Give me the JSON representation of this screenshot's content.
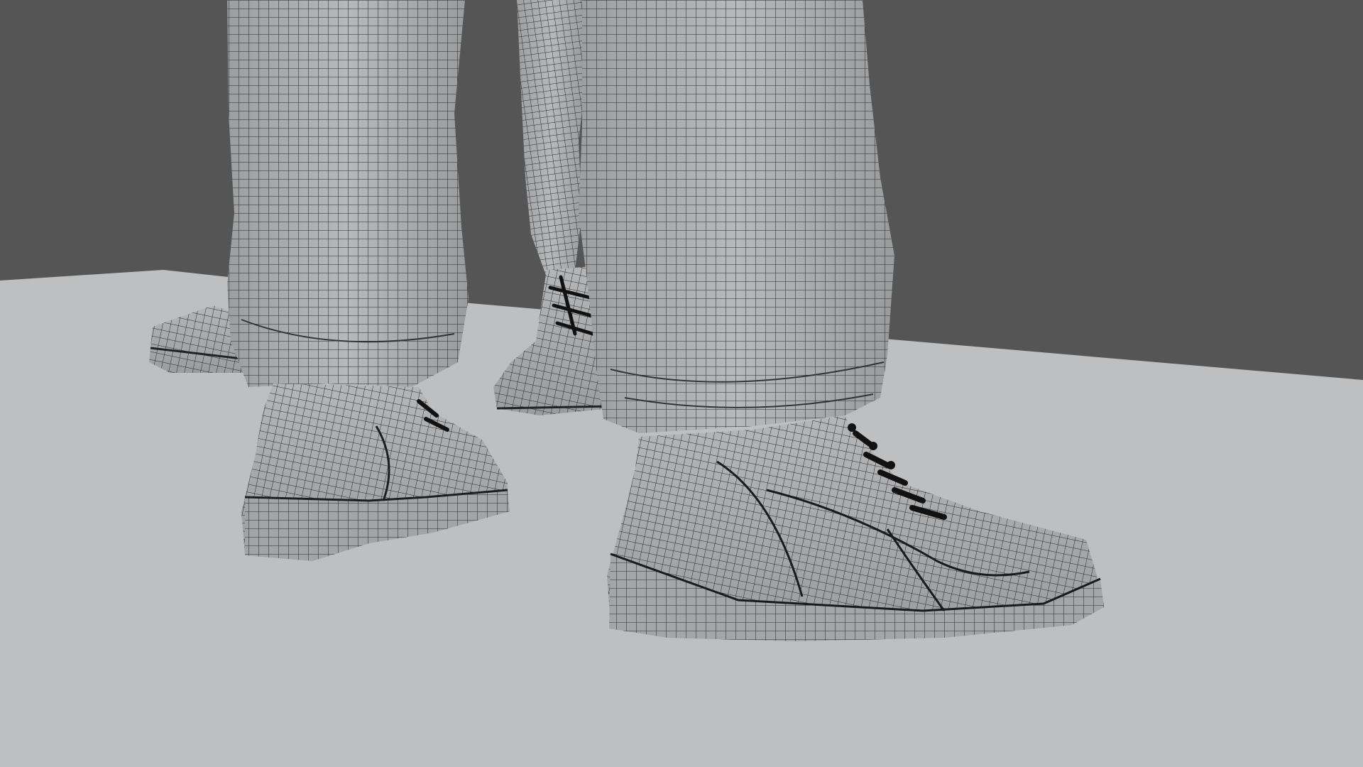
{
  "scene": {
    "description_free": true,
    "colors": {
      "wall": "#555555",
      "floor": "#bdbfc0",
      "mesh_fill": "#a9abad",
      "mesh_fill_light": "#b8babc",
      "mesh_fill_dark": "#8e9092",
      "wire": "#2a2a2a",
      "laces": "#111111"
    }
  }
}
